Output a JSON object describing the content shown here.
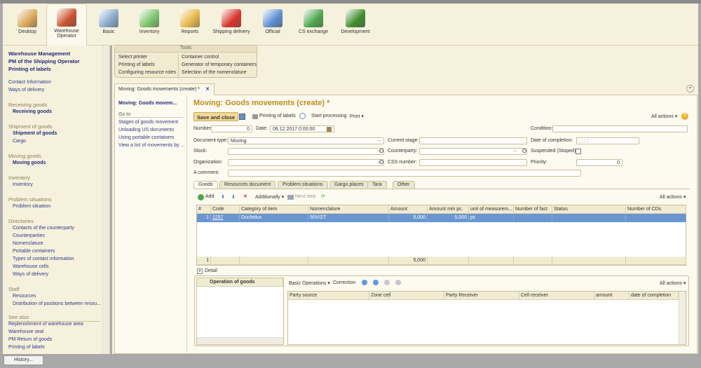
{
  "sections": [
    {
      "label": "Desktop",
      "icon": "desktop-icon",
      "color": "#d9a75a"
    },
    {
      "label": "Warehouse Operator",
      "icon": "forklift-icon",
      "color": "#c9502e"
    },
    {
      "label": "Basic",
      "icon": "warehouse-map-icon",
      "color": "#8aa8c9"
    },
    {
      "label": "Inventory",
      "icon": "boxes-icon",
      "color": "#7cc36b"
    },
    {
      "label": "Reports",
      "icon": "chart-icon",
      "color": "#e6b84a"
    },
    {
      "label": "Shipping delivery",
      "icon": "truck-icon",
      "color": "#d8332b"
    },
    {
      "label": "Official",
      "icon": "tools-icon",
      "color": "#5a8ed0"
    },
    {
      "label": "CS exchange",
      "icon": "exchange-icon",
      "color": "#4ca64c"
    },
    {
      "label": "Development",
      "icon": "monitor-icon",
      "color": "#3e8c2c"
    }
  ],
  "sidebar": {
    "top": [
      "Warehouse Management",
      "PM of the Shipping Operator",
      "Printing of labels"
    ],
    "links": [
      "Contact Information",
      "Ways of delivery"
    ],
    "groups": [
      {
        "title": "Receiving goods",
        "items": [
          {
            "label": "Receiving goods",
            "bold": true
          }
        ]
      },
      {
        "title": "Shipment of goods",
        "items": [
          {
            "label": "Shipment of goods",
            "bold": true
          },
          {
            "label": "Cargo"
          }
        ]
      },
      {
        "title": "Moving goods",
        "items": [
          {
            "label": "Moving goods",
            "bold": true
          }
        ]
      },
      {
        "title": "Inventory",
        "items": [
          {
            "label": "Inventory"
          }
        ]
      },
      {
        "title": "Problem situations",
        "items": [
          {
            "label": "Problem situation"
          }
        ]
      },
      {
        "title": "Directories",
        "items": [
          {
            "label": "Contacts of the counterparty"
          },
          {
            "label": "Counterparties"
          },
          {
            "label": "Nomenclature"
          },
          {
            "label": "Portable containers"
          },
          {
            "label": "Types of contact information"
          },
          {
            "label": "Warehouse cells"
          },
          {
            "label": "Ways of delivery"
          }
        ]
      },
      {
        "title": "Staff",
        "items": [
          {
            "label": "Resources"
          },
          {
            "label": "Distribution of positions between resou..."
          }
        ]
      }
    ],
    "see_also": "See also",
    "see_also_items": [
      "Replenishment of warehouse area",
      "Warehouse seal",
      "PM Return of goods",
      "Printing of labels"
    ]
  },
  "tools": {
    "title": "Tools",
    "col1": [
      "Select printer",
      "Printing of labels",
      "Configuring resource roles"
    ],
    "col2": [
      "Container control",
      "Generator of temporary containers",
      "Selection of the nomenclature"
    ]
  },
  "doc_tab": {
    "label": "Moving: Goods movements (create) *",
    "close": "✕"
  },
  "nav": {
    "current": "Moving: Goods movem...",
    "goto": "Go to",
    "items": [
      "Stages of goods movement",
      "Unloading US documents",
      "Using portable containers",
      "View a list of movements by ..."
    ]
  },
  "form": {
    "title": "Moving: Goods movements (create) *",
    "toolbar": {
      "save_close": "Save and close",
      "print_labels": "Printing of labels",
      "start": "Start processing",
      "print": "Print ▾",
      "all_actions": "All actions ▾",
      "help": "?"
    },
    "number_label": "Number:",
    "number": "0",
    "date_label": "Date:",
    "date": "06.12.2017  0:00:00",
    "condition_label": "Condition:",
    "condition": "",
    "doctype_label": "Document type:",
    "doctype": "Moving",
    "stage_label": "Current stage:",
    "stage": "",
    "completion_label": "Date of completion:",
    "completion": " .  .        :  :",
    "stock_label": "Stock:",
    "stock": "",
    "counterparty_label": "Counterparty:",
    "counterparty": "",
    "suspended_label": "Suspended (Stoped):",
    "org_label": "Organization:",
    "org": "",
    "css_label": "CSS number:",
    "css": "",
    "priority_label": "Priority:",
    "priority": "0",
    "comment_label": "A comment:",
    "comment": ""
  },
  "tabs": [
    "Goods",
    "Resources document",
    "Problem situations",
    "Gargo places",
    "Tara",
    "Other"
  ],
  "goods": {
    "toolbar": {
      "add": "Add",
      "additionally": "Additionally ▾",
      "next_step": "Next step",
      "all_actions": "All actions ▾"
    },
    "columns": [
      "#",
      "Code",
      "Category of item",
      "Nomenclature",
      "Amount",
      "Amount min pc.",
      "unit of measurem...",
      "Number of fact",
      "Status",
      "Number of CDs"
    ],
    "rows": [
      [
        "1",
        "1257",
        "Ducholux",
        "50V/ST",
        "5,000",
        "5,000",
        "pc",
        "",
        "",
        ""
      ]
    ],
    "footer": [
      "1",
      "",
      "",
      "",
      "5,000",
      "",
      "",
      "",
      "",
      ""
    ]
  },
  "detail": {
    "label": "Detail",
    "ops_header": "Operation of goods",
    "toolbar": {
      "basic": "Basic Operations ▾",
      "correction": "Correction",
      "all_actions": "All actions ▾"
    },
    "columns": [
      "Party source",
      "Zone cell",
      "Party Receiver",
      "Cell receiver",
      "amount",
      "date of completion"
    ]
  },
  "history": "History..."
}
